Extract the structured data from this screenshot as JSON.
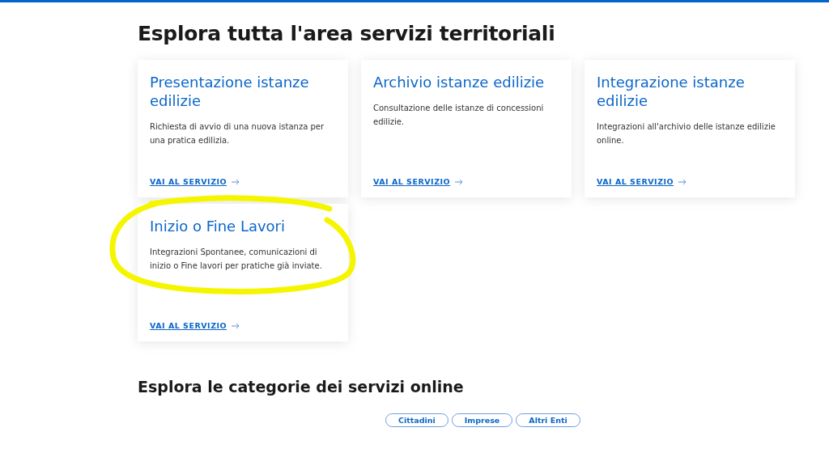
{
  "heading": "Esplora tutta l'area servizi territoriali",
  "cards": [
    {
      "title": "Presentazione istanze edilizie",
      "description": "Richiesta di avvio di una nuova istanza per una pratica edilizia.",
      "link": "VAI AL SERVIZIO",
      "highlighted": false
    },
    {
      "title": "Archivio istanze edilizie",
      "description": "Consultazione delle istanze di concessioni edilizie.",
      "link": "VAI AL SERVIZIO",
      "highlighted": false
    },
    {
      "title": "Integrazione istanze edilizie",
      "description": "Integrazioni all'archivio delle istanze edilizie online.",
      "link": "VAI AL SERVIZIO",
      "highlighted": false
    },
    {
      "title": "Inizio o Fine Lavori",
      "description": "Integrazioni Spontanee, comunicazioni di inizio o Fine lavori per pratiche già inviate.",
      "link": "VAI AL SERVIZIO",
      "highlighted": true
    }
  ],
  "categories_heading": "Esplora le categorie dei servizi online",
  "categories": [
    "Cittadini",
    "Imprese",
    "Altri Enti"
  ]
}
